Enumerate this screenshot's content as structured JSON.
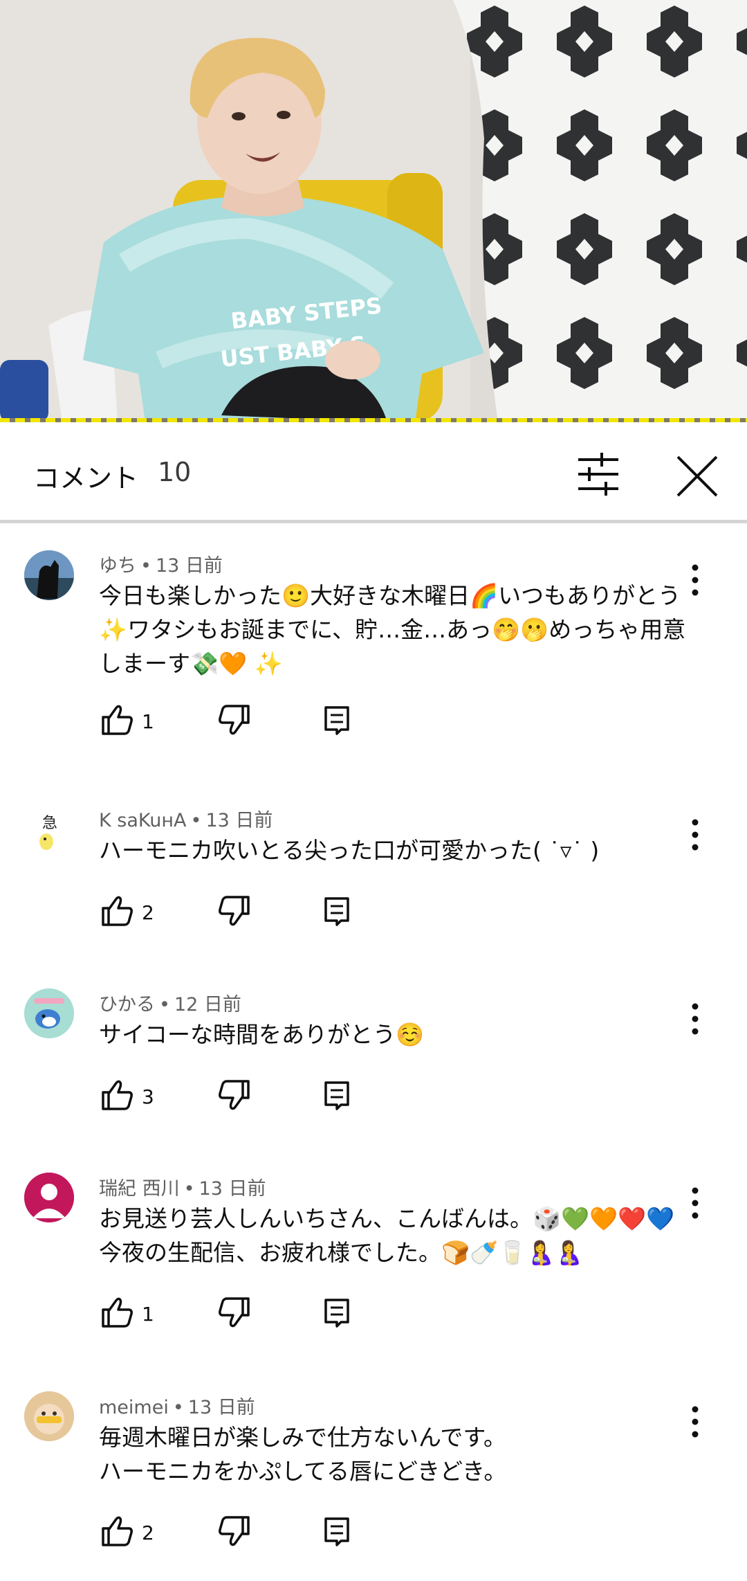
{
  "video": {
    "shirt_text_line1": "BABY STEPS",
    "shirt_text_line2": "UST BABY S"
  },
  "header": {
    "title": "コメント",
    "count": "10"
  },
  "icons": {
    "filter": "sliders-icon",
    "close": "close-icon",
    "more": "more-vert-icon",
    "like": "thumb-up-icon",
    "dislike": "thumb-down-icon",
    "reply": "reply-icon"
  },
  "comments": [
    {
      "author": "ゆち",
      "time": "13 日前",
      "text": "今日も楽しかった🙂大好きな木曜日🌈いつもありがとう✨ワタシもお誕までに、貯…金…あっ🤭🫢めっちゃ用意しまーす💸🧡 ✨",
      "likes": "1",
      "avatar_color": "#5a7fa8"
    },
    {
      "author": "K saKuнA",
      "time": "13 日前",
      "text": "ハーモニカ吹いとる尖った口が可愛かった( ˙▿˙ )",
      "likes": "2",
      "avatar_color": "#ffffff"
    },
    {
      "author": "ひかる",
      "time": "12 日前",
      "text": "サイコーな時間をありがとう☺️",
      "likes": "3",
      "avatar_color": "#9fd8d0"
    },
    {
      "author": "瑞紀 西川",
      "time": "13 日前",
      "text": "お見送り芸人しんいちさん、こんばんは。🎲💚🧡❤️💙今夜の生配信、お疲れ様でした。🍞🍼🥛🤱🤱",
      "likes": "1",
      "avatar_color": "#c2185b"
    },
    {
      "author": "meimei",
      "time": "13 日前",
      "text_line1": "毎週木曜日が楽しみで仕方ないんです。",
      "text_line2": "ハーモニカをかぷしてる唇にどきどき。",
      "likes": "2",
      "avatar_color": "#d9b98f"
    }
  ]
}
